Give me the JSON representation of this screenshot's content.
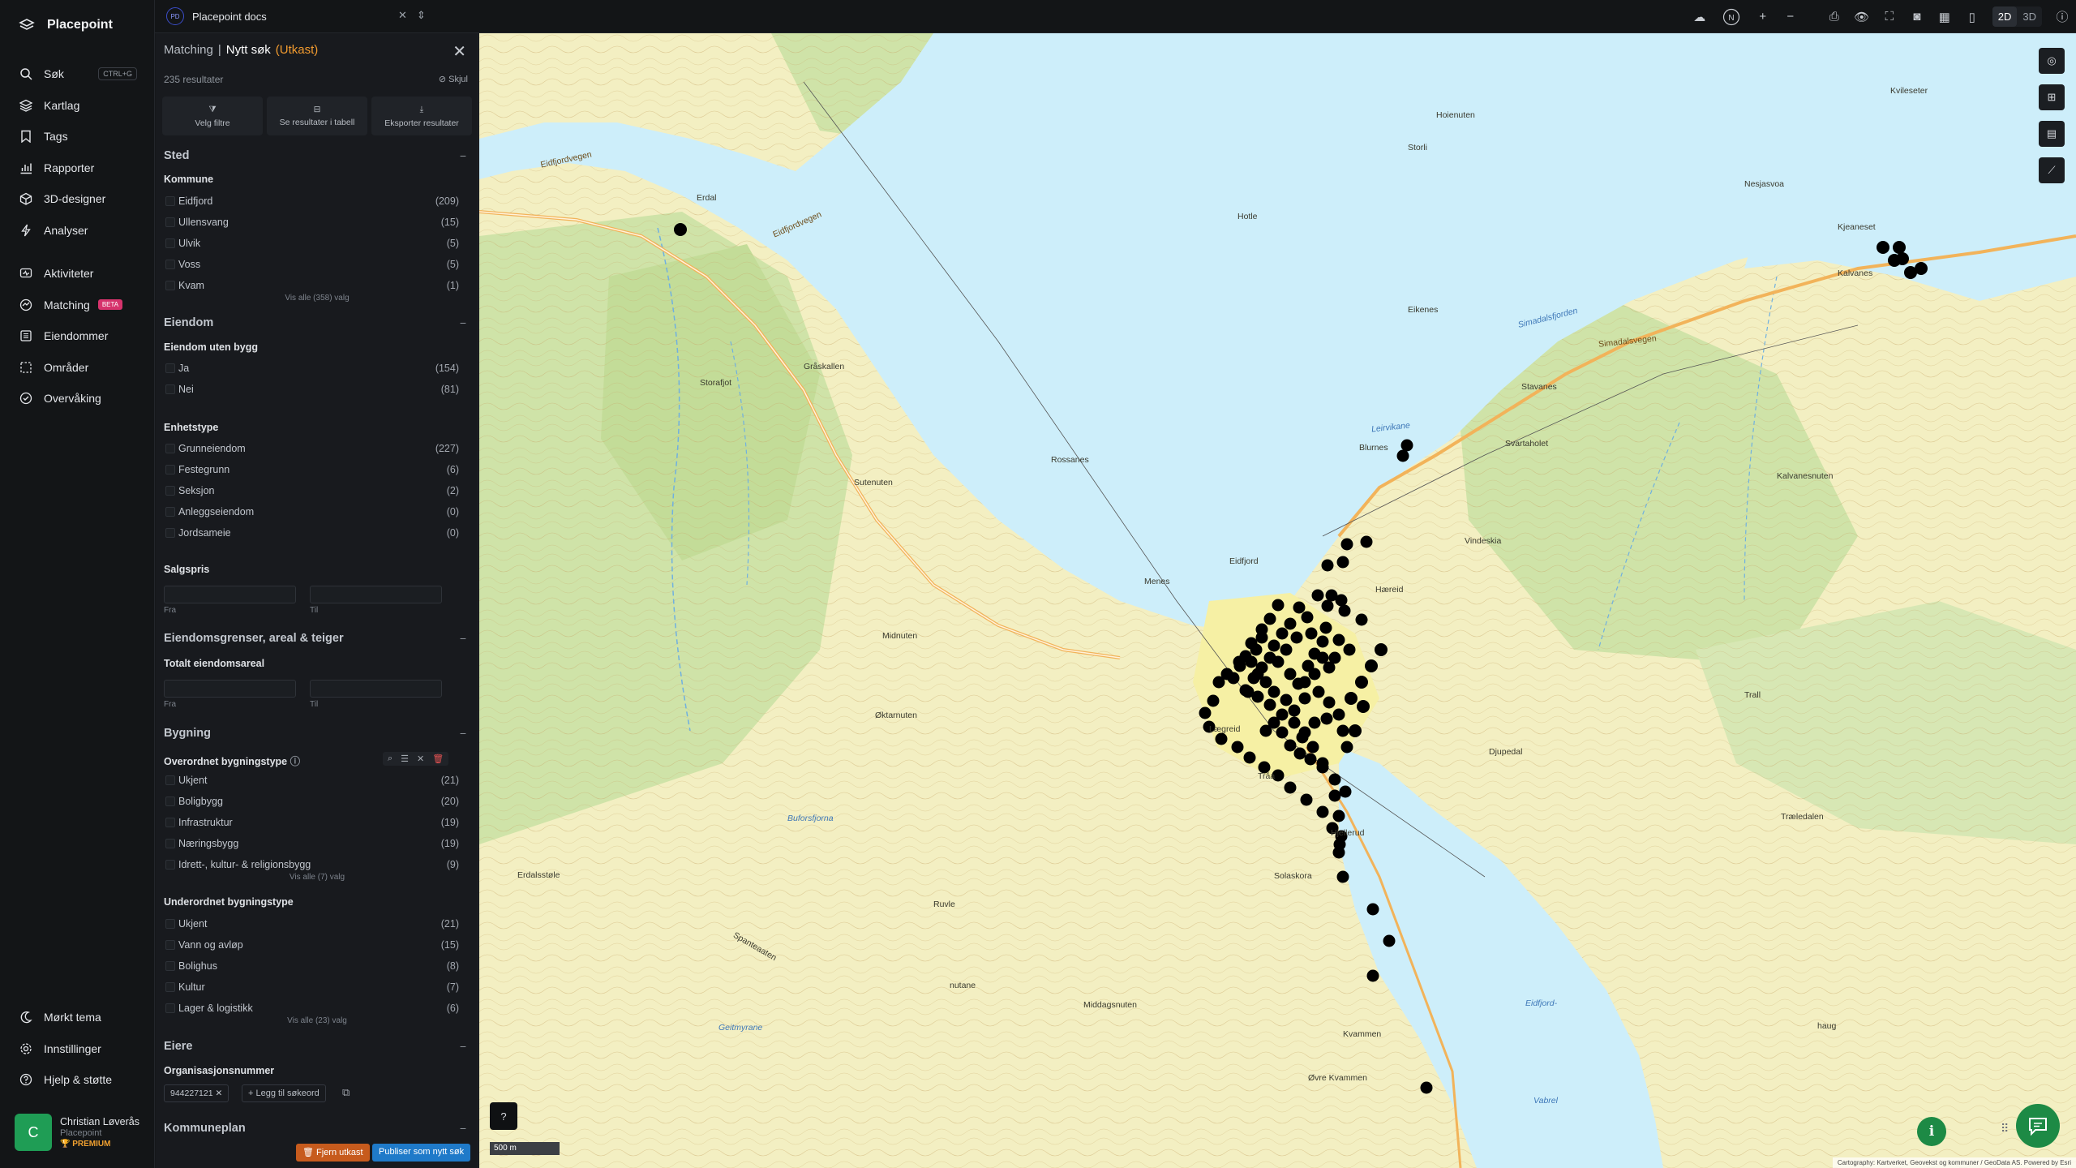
{
  "app": {
    "name": "Placepoint"
  },
  "nav": {
    "items": [
      {
        "label": "Søk",
        "shortcut": "CTRL+G"
      },
      {
        "label": "Kartlag"
      },
      {
        "label": "Tags"
      },
      {
        "label": "Rapporter"
      },
      {
        "label": "3D-designer"
      },
      {
        "label": "Analyser"
      }
    ],
    "items2": [
      {
        "label": "Aktiviteter"
      },
      {
        "label": "Matching",
        "badge": "BETA"
      },
      {
        "label": "Eiendommer"
      },
      {
        "label": "Områder"
      },
      {
        "label": "Overvåking"
      }
    ],
    "bottom": [
      {
        "label": "Mørkt tema"
      },
      {
        "label": "Innstillinger"
      },
      {
        "label": "Hjelp & støtte"
      }
    ],
    "user": {
      "initial": "C",
      "name": "Christian Løverås",
      "org": "Placepoint",
      "plan": "PREMIUM"
    }
  },
  "topbar": {
    "workspace_badge": "PD",
    "workspace": "Placepoint docs",
    "view_2d": "2D",
    "view_3d": "3D"
  },
  "panel": {
    "crumb": "Matching",
    "title": "Nytt søk",
    "status": "(Utkast)",
    "results": "235 resultater",
    "hide": "Skjul",
    "actions": [
      "Velg filtre",
      "Se resultater i tabell",
      "Eksporter resultater"
    ],
    "sted": {
      "title": "Sted",
      "kommune_title": "Kommune",
      "kommune": [
        {
          "label": "Eidfjord",
          "count": "(209)"
        },
        {
          "label": "Ullensvang",
          "count": "(15)"
        },
        {
          "label": "Ulvik",
          "count": "(5)"
        },
        {
          "label": "Voss",
          "count": "(5)"
        },
        {
          "label": "Kvam",
          "count": "(1)"
        }
      ],
      "show_all": "Vis alle (358) valg"
    },
    "eiendom": {
      "title": "Eiendom",
      "uten_bygg_title": "Eiendom uten bygg",
      "uten_bygg": [
        {
          "label": "Ja",
          "count": "(154)"
        },
        {
          "label": "Nei",
          "count": "(81)"
        }
      ],
      "enhetstype_title": "Enhetstype",
      "enhetstype": [
        {
          "label": "Grunneiendom",
          "count": "(227)"
        },
        {
          "label": "Festegrunn",
          "count": "(6)"
        },
        {
          "label": "Seksjon",
          "count": "(2)"
        },
        {
          "label": "Anleggseiendom",
          "count": "(0)"
        },
        {
          "label": "Jordsameie",
          "count": "(0)"
        }
      ],
      "salgspris_title": "Salgspris",
      "from": "Fra",
      "to": "Til"
    },
    "grenser": {
      "title": "Eiendomsgrenser, areal & teiger",
      "areal_title": "Totalt eiendomsareal",
      "from": "Fra",
      "to": "Til"
    },
    "bygning": {
      "title": "Bygning",
      "over_title": "Overordnet bygningstype",
      "over": [
        {
          "label": "Ukjent",
          "count": "(21)"
        },
        {
          "label": "Boligbygg",
          "count": "(20)"
        },
        {
          "label": "Infrastruktur",
          "count": "(19)"
        },
        {
          "label": "Næringsbygg",
          "count": "(19)"
        },
        {
          "label": "Idrett-, kultur- & religionsbygg",
          "count": "(9)"
        }
      ],
      "over_show_all": "Vis alle (7) valg",
      "under_title": "Underordnet bygningstype",
      "under": [
        {
          "label": "Ukjent",
          "count": "(21)"
        },
        {
          "label": "Vann og avløp",
          "count": "(15)"
        },
        {
          "label": "Bolighus",
          "count": "(8)"
        },
        {
          "label": "Kultur",
          "count": "(7)"
        },
        {
          "label": "Lager & logistikk",
          "count": "(6)"
        }
      ],
      "under_show_all": "Vis alle (23) valg"
    },
    "eiere": {
      "title": "Eiere",
      "org_title": "Organisasjonsnummer",
      "chip": "944227121",
      "add_keyword": "Legg til søkeord"
    },
    "kommuneplan": {
      "title": "Kommuneplan"
    },
    "buttons": {
      "remove": "Fjern utkast",
      "publish": "Publiser som nytt søk"
    }
  },
  "map": {
    "scale": "500 m",
    "attribution": "Cartography: Kartverket, Geovekst og kommuner / GeoData AS. Powered by Esri",
    "colors": {
      "water": "#cdeefa",
      "land": "#f3efc2",
      "forest": "#cfe3a8",
      "road": "#f2b35a",
      "marker": "#000000"
    },
    "labels": [
      {
        "t": "Eidfjordvegen",
        "k": "road"
      },
      {
        "t": "Eidfjordvegen",
        "k": "road"
      },
      {
        "t": "Erdal",
        "k": "land"
      },
      {
        "t": "Hoienuten",
        "k": "land"
      },
      {
        "t": "Hotle",
        "k": "land"
      },
      {
        "t": "Storli",
        "k": "land"
      },
      {
        "t": "Eikenes",
        "k": "land"
      },
      {
        "t": "Simadalsfjorden",
        "k": "water"
      },
      {
        "t": "Simadalsvegen",
        "k": "road"
      },
      {
        "t": "Kjeaneset",
        "k": "land"
      },
      {
        "t": "Kalvanes",
        "k": "land"
      },
      {
        "t": "Nesjasvoa",
        "k": "land"
      },
      {
        "t": "Kvileseter",
        "k": "land"
      },
      {
        "t": "Stavanes",
        "k": "land"
      },
      {
        "t": "Storafjot",
        "k": "land"
      },
      {
        "t": "Gråskallen",
        "k": "land"
      },
      {
        "t": "Rossanes",
        "k": "land"
      },
      {
        "t": "Blurnes",
        "k": "land"
      },
      {
        "t": "Leirvikane",
        "k": "water"
      },
      {
        "t": "Svartaholet",
        "k": "land"
      },
      {
        "t": "Kalvanesnuten",
        "k": "land"
      },
      {
        "t": "Sutenuten",
        "k": "land"
      },
      {
        "t": "Eidfjord",
        "k": "land"
      },
      {
        "t": "Menes",
        "k": "land"
      },
      {
        "t": "Midnuten",
        "k": "land"
      },
      {
        "t": "Hæreid",
        "k": "land"
      },
      {
        "t": "Vindeskia",
        "k": "land"
      },
      {
        "t": "Øktarnuten",
        "k": "land"
      },
      {
        "t": "Lægreid",
        "k": "land"
      },
      {
        "t": "Tråa",
        "k": "land"
      },
      {
        "t": "Djupedal",
        "k": "land"
      },
      {
        "t": "Trall",
        "k": "land"
      },
      {
        "t": "Hjellerud",
        "k": "land"
      },
      {
        "t": "Buforsfjorna",
        "k": "water"
      },
      {
        "t": "Erdalsstøle",
        "k": "land"
      },
      {
        "t": "Ruvle",
        "k": "land"
      },
      {
        "t": "Solaskora",
        "k": "land"
      },
      {
        "t": "Træledalen",
        "k": "land"
      },
      {
        "t": "nutane",
        "k": "land"
      },
      {
        "t": "Middagsnuten",
        "k": "land"
      },
      {
        "t": "Eidfjord-",
        "k": "water"
      },
      {
        "t": "Kvammen",
        "k": "land"
      },
      {
        "t": "Øvre Kvammen",
        "k": "land"
      },
      {
        "t": "haug",
        "k": "land"
      },
      {
        "t": "Vabrel",
        "k": "water"
      },
      {
        "t": "Geitmyrane",
        "k": "water"
      },
      {
        "t": "Spanteaaten",
        "k": "land"
      }
    ]
  }
}
